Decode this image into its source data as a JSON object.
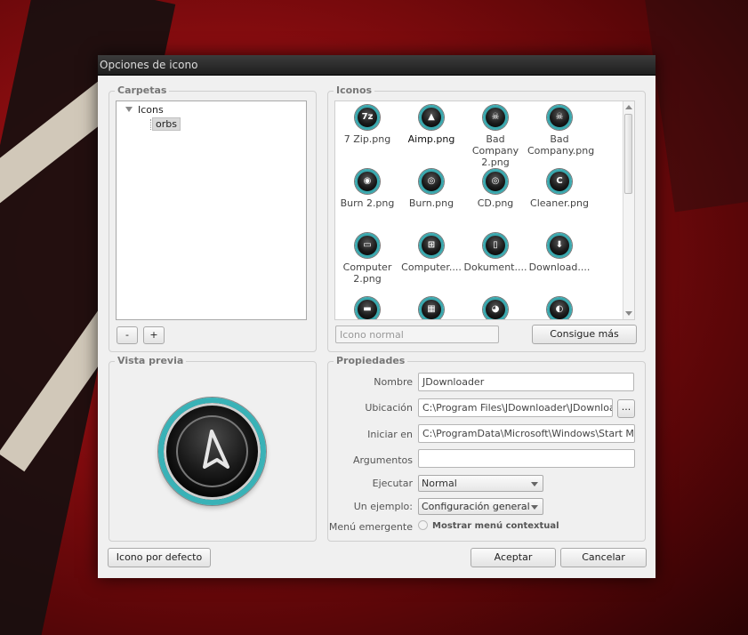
{
  "dialog": {
    "title": "Opciones de icono"
  },
  "folders": {
    "title": "Carpetas",
    "tree": {
      "root": "Icons",
      "child": "orbs"
    },
    "remove_label": "-",
    "add_label": "+"
  },
  "icons": {
    "title": "Iconos",
    "items": [
      {
        "label": "7 Zip.png",
        "glyph": "7z",
        "icon": "7zip-orb-icon"
      },
      {
        "label": "Aimp.png",
        "glyph": "▲",
        "icon": "aimp-orb-icon"
      },
      {
        "label": "Bad Company 2.png",
        "glyph": "☠",
        "icon": "bad-company-2-orb-icon"
      },
      {
        "label": "Bad Company.png",
        "glyph": "☠",
        "icon": "bad-company-orb-icon"
      },
      {
        "label": "Burn 2.png",
        "glyph": "◉",
        "icon": "burn-2-orb-icon"
      },
      {
        "label": "Burn.png",
        "glyph": "◎",
        "icon": "burn-orb-icon"
      },
      {
        "label": "CD.png",
        "glyph": "◎",
        "icon": "cd-orb-icon"
      },
      {
        "label": "Cleaner.png",
        "glyph": "C",
        "icon": "cleaner-orb-icon"
      },
      {
        "label": "Computer 2.png",
        "glyph": "▭",
        "icon": "computer-2-orb-icon"
      },
      {
        "label": "Computer....",
        "glyph": "⊞",
        "icon": "computer-orb-icon"
      },
      {
        "label": "Dokument....",
        "glyph": "▯",
        "icon": "dokument-orb-icon"
      },
      {
        "label": "Download....",
        "glyph": "⬇",
        "icon": "download-orb-icon"
      },
      {
        "label": "",
        "glyph": "▬",
        "icon": "partial-orb-icon-1"
      },
      {
        "label": "",
        "glyph": "▦",
        "icon": "partial-orb-icon-2"
      },
      {
        "label": "",
        "glyph": "◕",
        "icon": "partial-orb-icon-3"
      },
      {
        "label": "",
        "glyph": "◐",
        "icon": "partial-orb-icon-4"
      }
    ],
    "search_placeholder": "Icono normal",
    "get_more_label": "Consigue más"
  },
  "preview": {
    "title": "Vista previa",
    "glyph": "▲"
  },
  "properties": {
    "title": "Propiedades",
    "name_label": "Nombre",
    "name_value": "JDownloader",
    "location_label": "Ubicación",
    "location_value": "C:\\Program Files\\JDownloader\\JDownloader",
    "browse_label": "...",
    "start_in_label": "Iniciar en",
    "start_in_value": "C:\\ProgramData\\Microsoft\\Windows\\Start Menu\\P",
    "args_label": "Argumentos",
    "args_value": "",
    "run_label": "Ejecutar",
    "run_value": "Normal",
    "example_label": "Un ejemplo:",
    "example_value": "Configuración general",
    "popup_label": "Menú emergente",
    "popup_option": "Mostrar menú contextual"
  },
  "buttons": {
    "default_icon": "Icono por defecto",
    "accept": "Aceptar",
    "cancel": "Cancelar"
  },
  "colors": {
    "accent": "#39b2b7",
    "window": "#f0f0f0",
    "titlebar": "#1e1e1e"
  }
}
